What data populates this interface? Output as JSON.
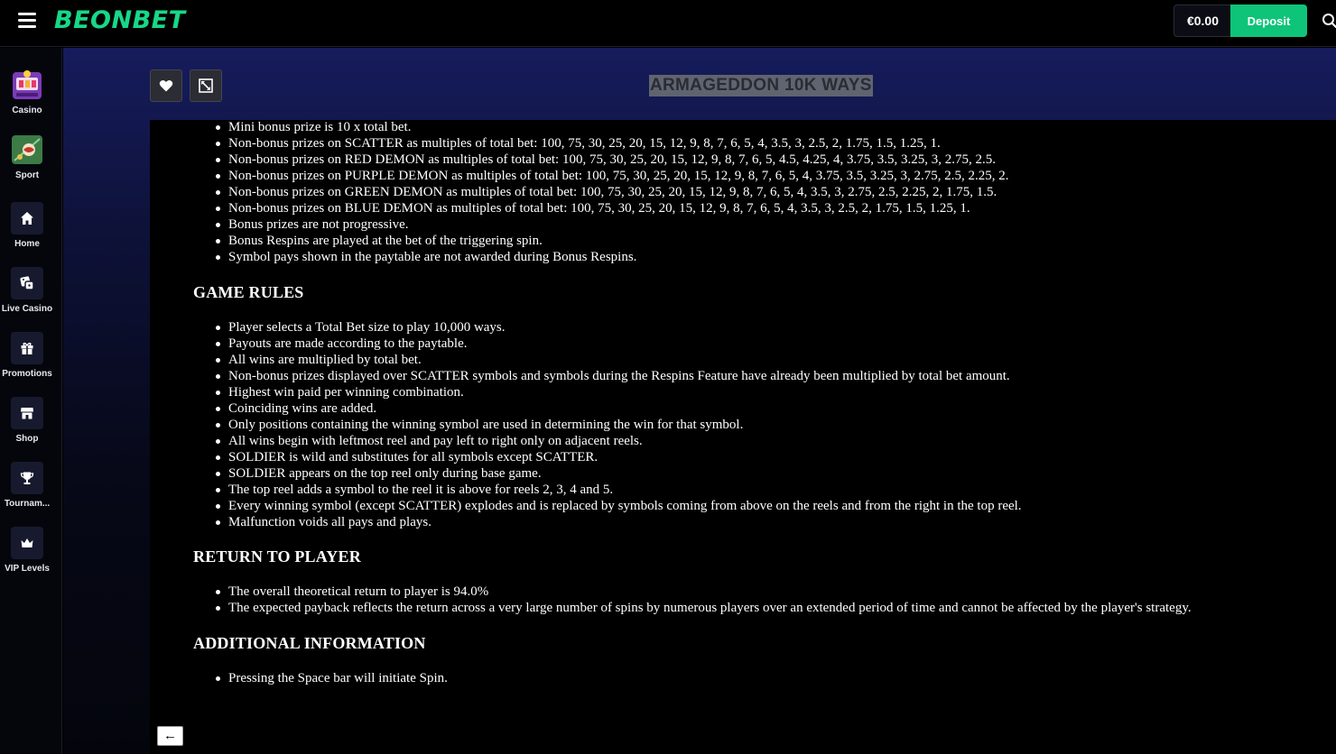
{
  "header": {
    "logo": "BEONBET",
    "balance": "€0.00",
    "deposit_label": "Deposit"
  },
  "sidebar": {
    "items": [
      {
        "label": "Casino",
        "icon": "casino-icon"
      },
      {
        "label": "Sport",
        "icon": "sport-icon"
      },
      {
        "label": "Home",
        "icon": "home-icon"
      },
      {
        "label": "Live Casino",
        "icon": "dice-icon"
      },
      {
        "label": "Promotions",
        "icon": "gift-icon"
      },
      {
        "label": "Shop",
        "icon": "shop-icon"
      },
      {
        "label": "Tournam...",
        "icon": "trophy-icon"
      },
      {
        "label": "VIP Levels",
        "icon": "crown-icon"
      }
    ]
  },
  "game": {
    "title": "ARMAGEDDON 10K WAYS"
  },
  "rules": {
    "cut_top_line": "Mini bonus prize is 10 x total bet.",
    "bonus_items": [
      "Non-bonus prizes on SCATTER as multiples of total bet: 100, 75, 30, 25, 20, 15, 12, 9, 8, 7, 6, 5, 4, 3.5, 3, 2.5, 2, 1.75, 1.5, 1.25, 1.",
      "Non-bonus prizes on RED DEMON as multiples of total bet: 100, 75, 30, 25, 20, 15, 12, 9, 8, 7, 6, 5, 4.5, 4.25, 4, 3.75, 3.5, 3.25, 3, 2.75, 2.5.",
      "Non-bonus prizes on PURPLE DEMON as multiples of total bet: 100, 75, 30, 25, 20, 15, 12, 9, 8, 7, 6, 5, 4, 3.75, 3.5, 3.25, 3, 2.75, 2.5, 2.25, 2.",
      "Non-bonus prizes on GREEN DEMON as multiples of total bet: 100, 75, 30, 25, 20, 15, 12, 9, 8, 7, 6, 5, 4, 3.5, 3, 2.75, 2.5, 2.25, 2, 1.75, 1.5.",
      "Non-bonus prizes on BLUE DEMON as multiples of total bet: 100, 75, 30, 25, 20, 15, 12, 9, 8, 7, 6, 5, 4, 3.5, 3, 2.5, 2, 1.75, 1.5, 1.25, 1.",
      "Bonus prizes are not progressive.",
      "Bonus Respins are played at the bet of the triggering spin.",
      "Symbol pays shown in the paytable are not awarded during Bonus Respins."
    ],
    "game_rules_heading": "GAME RULES",
    "game_rules_items": [
      "Player selects a Total Bet size to play 10,000 ways.",
      "Payouts are made according to the paytable.",
      "All wins are multiplied by total bet.",
      "Non-bonus prizes displayed over SCATTER symbols and symbols during the Respins Feature have already been multiplied by total bet amount.",
      "Highest win paid per winning combination.",
      "Coinciding wins are added.",
      "Only positions containing the winning symbol are used in determining the win for that symbol.",
      "All wins begin with leftmost reel and pay left to right only on adjacent reels.",
      "SOLDIER is wild and substitutes for all symbols except SCATTER.",
      "SOLDIER appears on the top reel only during base game.",
      "The top reel adds a symbol to the reel it is above for reels 2, 3, 4 and 5.",
      "Every winning symbol (except SCATTER) explodes and is replaced by symbols coming from above on the reels and from the right in the top reel.",
      "Malfunction voids all pays and plays."
    ],
    "rtp_heading": "RETURN TO PLAYER",
    "rtp_items": [
      "The overall theoretical return to player is 94.0%",
      "The expected payback reflects the return across a very large number of spins by numerous players over an extended period of time and cannot be affected by the player's strategy."
    ],
    "additional_heading": "ADDITIONAL INFORMATION",
    "additional_items": [
      "Pressing the Space bar will initiate Spin."
    ],
    "back_label": "←"
  }
}
